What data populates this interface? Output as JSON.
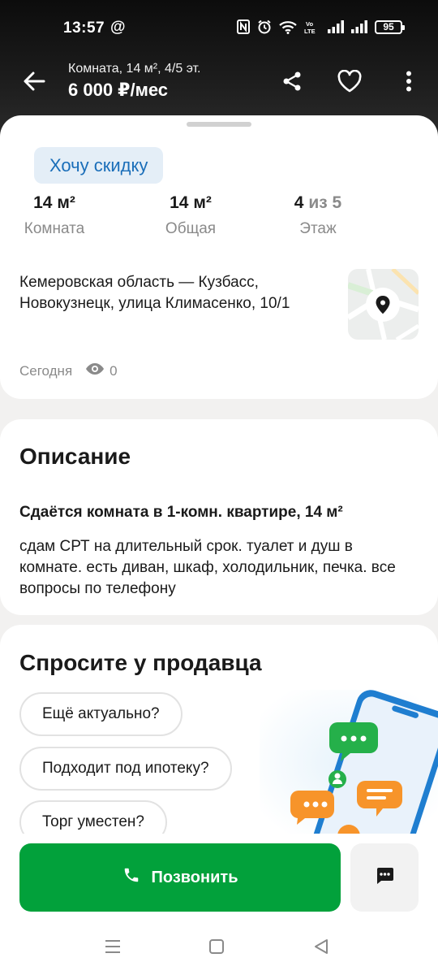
{
  "status_bar": {
    "time": "13:57",
    "at_symbol": "@",
    "battery": "95",
    "icons": [
      "nfc-icon",
      "alarm-icon",
      "wifi-icon",
      "volte-icon",
      "signal-icon",
      "signal-icon"
    ]
  },
  "toolbar": {
    "subtitle": "Комната, 14 м², 4/5 эт.",
    "price": "6 000 ₽/мес",
    "icons": [
      "back-arrow-icon",
      "share-icon",
      "heart-icon",
      "more-vertical-icon"
    ]
  },
  "summary": {
    "discount_label": "Хочу скидку",
    "stats": [
      {
        "value": "14 м²",
        "label": "Комната"
      },
      {
        "value": "14 м²",
        "label": "Общая"
      },
      {
        "value_main": "4",
        "value_muted": "из 5",
        "label": "Этаж"
      }
    ],
    "address": "Кемеровская область — Кузбасс, Новокузнецк, улица Климасенко, 10/1",
    "date": "Сегодня",
    "views": "0"
  },
  "description": {
    "heading": "Описание",
    "title": "Сдаётся комната в 1-комн. квартире, 14 м²",
    "text": "сдам СРТ на длительный срок. туалет и душ в комнате. есть диван, шкаф, холодильник, печка. все вопросы по телефону"
  },
  "ask_seller": {
    "heading": "Спросите у продавца",
    "questions": [
      "Ещё актуально?",
      "Подходит под ипотеку?",
      "Торг уместен?"
    ]
  },
  "actions": {
    "call_label": "Позвонить"
  },
  "colors": {
    "accent_green": "#02a13b",
    "link_blue": "#1a6eb9",
    "chip_bg": "#e4eef7"
  }
}
